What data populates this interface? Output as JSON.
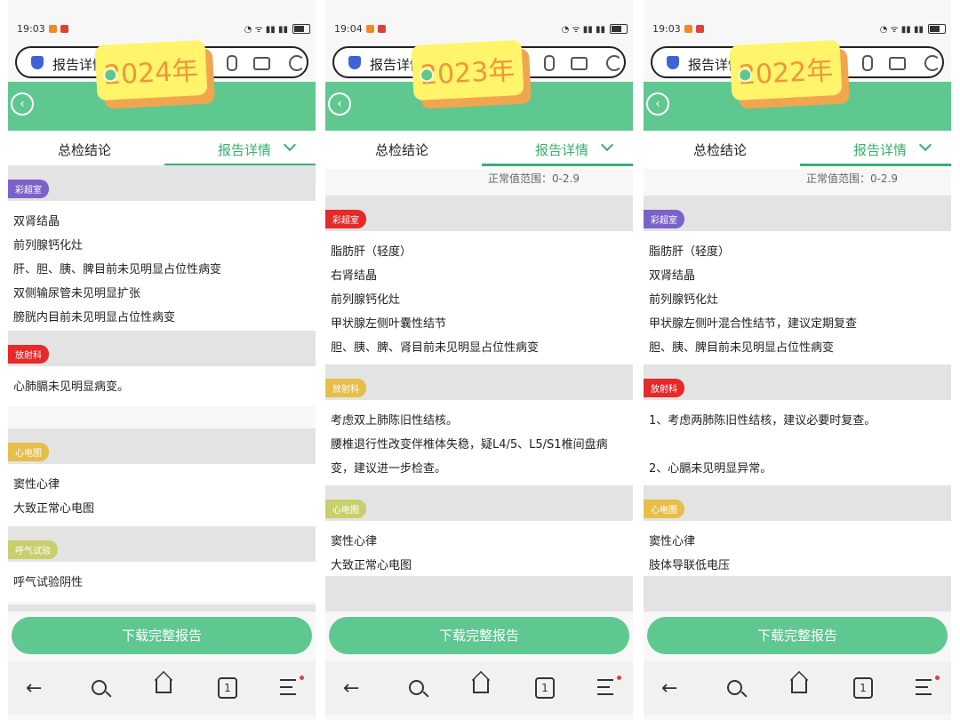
{
  "screens": [
    {
      "time": "19:03",
      "year_tag": "2024年",
      "addr_title": "报告详情",
      "tab_left": "总检结论",
      "tab_right": "报告详情",
      "range": "",
      "download": "下载完整报告",
      "nav_tab_count": "1",
      "sections": [
        {
          "tag": "彩超室",
          "color": "#7b62c9",
          "items": [
            "双肾结晶",
            "前列腺钙化灶",
            "肝、胆、胰、脾目前未见明显占位性病变",
            "双侧输尿管未见明显扩张",
            "膀胱内目前未见明显占位性病变"
          ]
        },
        {
          "tag": "放射科",
          "color": "#e52a2a",
          "items": [
            "心肺膈未见明显病变。"
          ]
        },
        {
          "tag": "心电图",
          "color": "#e6be4a",
          "items": [
            "窦性心律",
            "大致正常心电图"
          ]
        },
        {
          "tag": "呼气试验",
          "color": "#c9cf6b",
          "items": [
            "呼气试验阴性"
          ]
        }
      ]
    },
    {
      "time": "19:04",
      "year_tag": "2023年",
      "addr_title": "报告详情",
      "tab_left": "总检结论",
      "tab_right": "报告详情",
      "range": "正常值范围：0-2.9",
      "download": "下载完整报告",
      "nav_tab_count": "1",
      "sections": [
        {
          "tag": "彩超室",
          "color": "#e52a2a",
          "items": [
            "脂肪肝（轻度）",
            "右肾结晶",
            "前列腺钙化灶",
            "甲状腺左侧叶囊性结节",
            "胆、胰、脾、肾目前未见明显占位性病变"
          ]
        },
        {
          "tag": "放射科",
          "color": "#e6be4a",
          "items": [
            "考虑双上肺陈旧性结核。",
            "腰椎退行性改变伴椎体失稳，疑L4/5、L5/S1椎间盘病",
            "变，建议进一步检查。"
          ]
        },
        {
          "tag": "心电图",
          "color": "#c9cf6b",
          "items": [
            "窦性心律",
            "大致正常心电图"
          ]
        }
      ]
    },
    {
      "time": "19:03",
      "year_tag": "2022年",
      "addr_title": "报告详情",
      "tab_left": "总检结论",
      "tab_right": "报告详情",
      "range": "正常值范围：0-2.9",
      "download": "下载完整报告",
      "nav_tab_count": "1",
      "sections": [
        {
          "tag": "彩超室",
          "color": "#7b62c9",
          "items": [
            "脂肪肝（轻度）",
            "双肾结晶",
            "前列腺钙化灶",
            "甲状腺左侧叶混合性结节，建议定期复查",
            "胆、胰、脾目前未见明显占位性病变"
          ]
        },
        {
          "tag": "放射科",
          "color": "#e52a2a",
          "items": [
            "1、考虑两肺陈旧性结核，建议必要时复查。",
            "",
            "2、心膈未见明显异常。"
          ]
        },
        {
          "tag": "心电图",
          "color": "#e6be4a",
          "items": [
            "窦性心律",
            "肢体导联低电压"
          ]
        }
      ]
    }
  ]
}
